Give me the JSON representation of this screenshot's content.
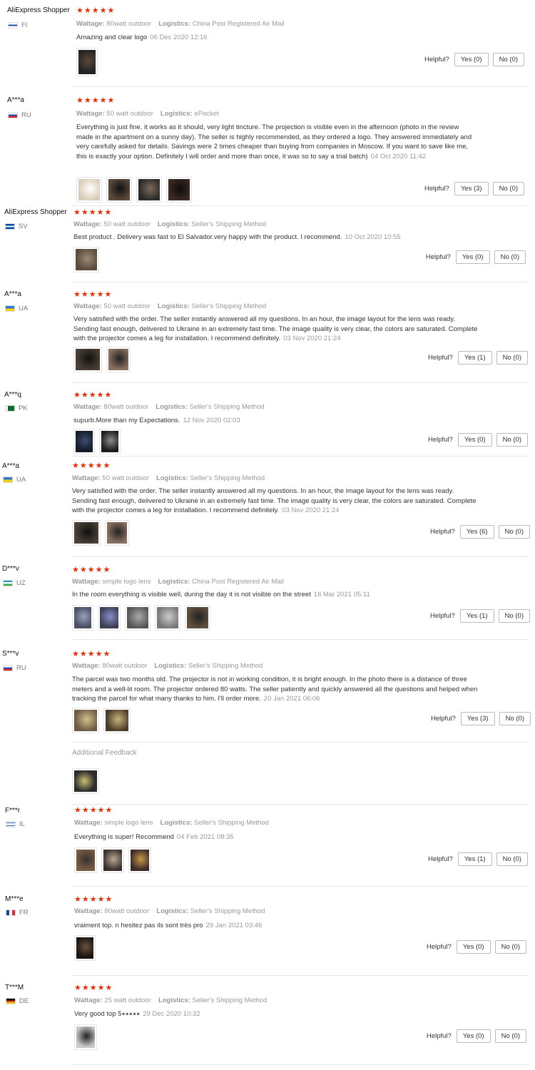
{
  "labels": {
    "wattage": "Wattage:",
    "logistics": "Logistics:",
    "helpful": "Helpful?",
    "additional_feedback": "Additional Feedback"
  },
  "stars": "★★★★★",
  "colors": {
    "star": "#e62e04",
    "meta_text": "#999999",
    "border": "#e8e8e8"
  },
  "reviews": [
    {
      "user": "AliExpress Shopper",
      "country": "FI",
      "flag": "finland",
      "wattage": "80watt outdoor",
      "logistics": "China Post Registered Air Mail",
      "text": "Amazing and clear logo",
      "date": "06 Dec 2020 12:16",
      "photos": [
        "night-lamp-photo"
      ],
      "yes": "Yes (0)",
      "no": "No (0)"
    },
    {
      "user": "A***a",
      "country": "RU",
      "flag": "russia",
      "wattage": "50 watt outdoor",
      "logistics": "ePacket",
      "text": "Everything is just fine, it works as it should, very light tincture. The projection is visible even in the afternoon (photo in the review made in the apartment on a sunny day). The seller is highly recommended, as they ordered a logo. They answered immediately and very carefully asked for details. Savings were 2 times cheaper than buying from companies in Moscow. If you want to save like me, this is exactly your option. Definitely I will order and more than once, it was so to say a trial batch)",
      "date": "04 Oct 2020 11:42",
      "photos": [
        "logo-projection-photo",
        "projector-photo",
        "lens-photo",
        "lens-closeup-photo"
      ],
      "yes": "Yes (3)",
      "no": "No (0)"
    },
    {
      "user": "AliExpress Shopper",
      "country": "SV",
      "flag": "el-salvador",
      "wattage": "50 watt outdoor",
      "logistics": "Seller's Shipping Method",
      "text": "Best product . Delivery was fast to El Salvador.very happy with the product. I recommend.",
      "date": "10 Oct 2020 10:55",
      "photos": [
        "product-photo"
      ],
      "yes": "Yes (0)",
      "no": "No (0)"
    },
    {
      "user": "A***a",
      "country": "UA",
      "flag": "ukraine",
      "wattage": "50 watt outdoor",
      "logistics": "Seller's Shipping Method",
      "text": "Very satisfied with the order. The seller instantly answered all my questions. In an hour, the image layout for the lens was ready. Sending fast enough, delivered to Ukraine in an extremely fast time. The image quality is very clear, the colors are saturated. Complete with the projector comes a leg for installation. I recommend definitely.",
      "date": "03 Nov 2020 21:24",
      "photos": [
        "projector-box-photo",
        "mount-photo"
      ],
      "yes": "Yes (1)",
      "no": "No (0)"
    },
    {
      "user": "A***q",
      "country": "PK",
      "flag": "pakistan",
      "wattage": "80watt outdoor",
      "logistics": "Seller's Shipping Method",
      "text": "supurb.More than my Expectations.",
      "date": "12 Nov 2020 02:03",
      "photos": [
        "projection-night-photo",
        "projection-wall-photo"
      ],
      "yes": "Yes (0)",
      "no": "No (0)"
    },
    {
      "user": "A***a",
      "country": "UA",
      "flag": "ukraine",
      "wattage": "50 watt outdoor",
      "logistics": "Seller's Shipping Method",
      "text": "Very satisfied with the order. The seller instantly answered all my questions. In an hour, the image layout for the lens was ready. Sending fast enough, delivered to Ukraine in an extremely fast time. The image quality is very clear, the colors are saturated. Complete with the projector comes a leg for installation. I recommend definitely.",
      "date": "03 Nov 2020 21:24",
      "photos": [
        "projector-box-photo",
        "mount-photo"
      ],
      "yes": "Yes (6)",
      "no": "No (0)"
    },
    {
      "user": "D***v",
      "country": "UZ",
      "flag": "uzbekistan",
      "wattage": "simple logo lens",
      "logistics": "China Post Registered Air Mail",
      "text": "In the room everything is visible well, during the day it is not visible on the street",
      "date": "16 Mar 2021 05:11",
      "photos": [
        "room-projection-photo",
        "room-projection-photo-2",
        "projector-table-photo",
        "projector-desk-photo",
        "projector-unit-photo"
      ],
      "yes": "Yes (1)",
      "no": "No (0)"
    },
    {
      "user": "S***v",
      "country": "RU",
      "flag": "russia",
      "wattage": "80watt outdoor",
      "logistics": "Seller's Shipping Method",
      "text": "The parcel was two months old. The projector is not in working condition, it is bright enough. In the photo there is a distance of three meters and a well-lit room. The projector ordered 80 watts. The seller patiently and quickly answered all the questions and helped when tracking the parcel for what many thanks to him. I'll order more.",
      "date": "20 Jan 2021 06:06",
      "photos": [
        "wall-logo-photo",
        "wall-logo-photo-2"
      ],
      "yes": "Yes (3)",
      "no": "No (0)",
      "additional_photos": [
        "additional-logo-photo"
      ]
    },
    {
      "user": "F***r",
      "country": "IL",
      "flag": "israel",
      "wattage": "simple logo lens",
      "logistics": "Seller's Shipping Method",
      "text": "Everything is super! Recommend",
      "date": "04 Feb 2021 08:35",
      "photos": [
        "projector-mounted-photo",
        "ceiling-photo",
        "building-projection-photo"
      ],
      "yes": "Yes (1)",
      "no": "No (0)"
    },
    {
      "user": "M***e",
      "country": "FR",
      "flag": "france",
      "wattage": "80watt outdoor",
      "logistics": "Seller's Shipping Method",
      "text": "vraiment top. n hesitez pas ils sont très pro",
      "date": "29 Jan 2021 03:46",
      "photos": [
        "dark-room-photo"
      ],
      "yes": "Yes (0)",
      "no": "No (0)"
    },
    {
      "user": "T***M",
      "country": "DE",
      "flag": "germany",
      "wattage": "25 watt outdoor",
      "logistics": "Seller's Shipping Method",
      "text": "Very good top 5⭑⭑⭑⭑⭑",
      "date": "29 Dec 2020 10:32",
      "photos": [
        "device-photo"
      ],
      "yes": "Yes (0)",
      "no": "No (0)"
    }
  ]
}
